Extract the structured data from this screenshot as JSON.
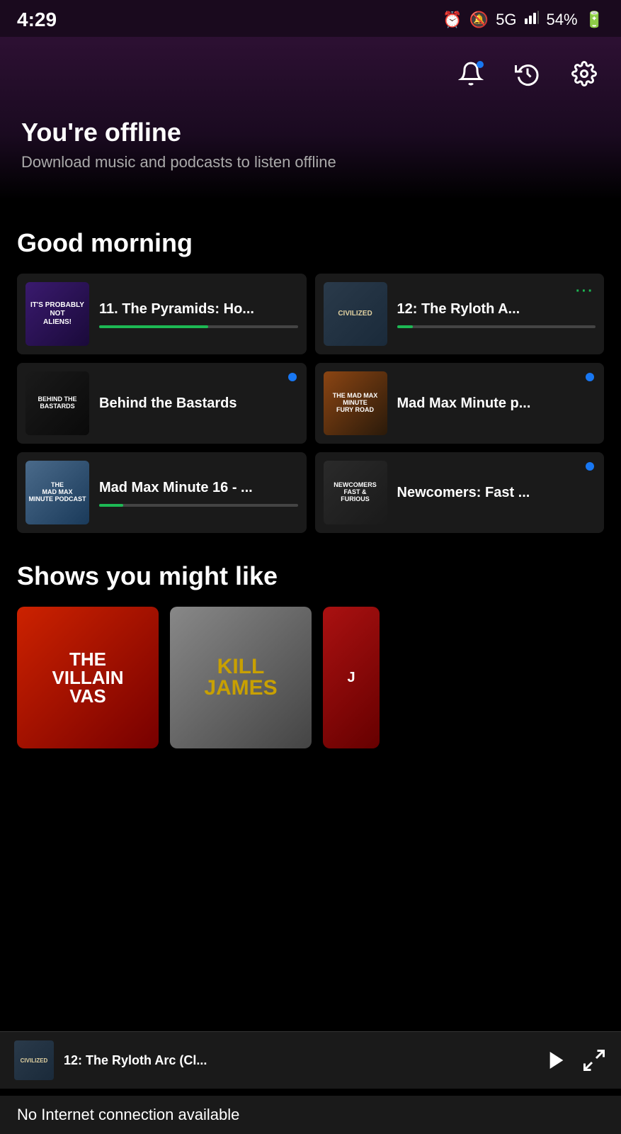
{
  "statusBar": {
    "time": "4:29",
    "battery": "54%",
    "signal": "5G"
  },
  "header": {
    "offline_title": "You're offline",
    "offline_subtitle": "Download music and podcasts to listen offline"
  },
  "greeting": {
    "title": "Good morning"
  },
  "podcasts": [
    {
      "id": "aliens",
      "title": "11. The Pyramids: Ho...",
      "thumb_text": "IT'S PROBABLY\nNOT\nALIENS!",
      "progress": 55,
      "has_dot": false,
      "has_menu_dots": false,
      "progress_color": "#1db954"
    },
    {
      "id": "civilized",
      "title": "12: The Ryloth A...",
      "thumb_text": "CIVILIZED",
      "progress": 8,
      "has_dot": false,
      "has_menu_dots": true,
      "progress_color": "#1db954"
    },
    {
      "id": "bastards",
      "title": "Behind the Bastards",
      "thumb_text": "BEHIND THE\nBASTARDS",
      "progress": 0,
      "has_dot": true,
      "has_menu_dots": false,
      "progress_color": "#1db954"
    },
    {
      "id": "madmax-fury",
      "title": "Mad Max Minute p...",
      "thumb_text": "THE MAD MAX\nMINUTE\nFURY ROAD",
      "progress": 0,
      "has_dot": true,
      "has_menu_dots": false,
      "progress_color": "#1db954"
    },
    {
      "id": "madmax16",
      "title": "Mad Max Minute 16 - ...",
      "thumb_text": "THE\nMAD MAX\nMINUTE PODCAST",
      "progress": 10,
      "has_dot": false,
      "has_menu_dots": false,
      "progress_color": "#1db954"
    },
    {
      "id": "newcomers",
      "title": "Newcomers: Fast ...",
      "thumb_text": "NEWCOMERS\nFAST &\nFURIOUS",
      "progress": 0,
      "has_dot": true,
      "has_menu_dots": false,
      "progress_color": "#1db954"
    }
  ],
  "shows_section": {
    "title": "Shows you might like",
    "shows": [
      {
        "id": "villain",
        "text": "THE\nVILLAIN\nVAS"
      },
      {
        "id": "kill",
        "text": "KILL\nJAMES"
      },
      {
        "id": "partial",
        "text": "J"
      }
    ]
  },
  "bottom_bar": {
    "text": "No Internet connection available"
  },
  "mini_player": {
    "thumb_text": "CIVILIZED",
    "title": "12: The Ryloth Arc (Cl..."
  },
  "icons": {
    "bell": "bell-icon",
    "history": "history-icon",
    "settings": "settings-icon"
  }
}
